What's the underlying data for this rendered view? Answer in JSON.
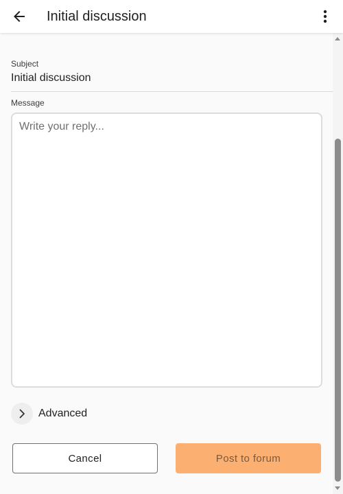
{
  "header": {
    "title": "Initial discussion",
    "back_icon": "arrow-left-icon",
    "menu_icon": "more-vert-icon"
  },
  "form": {
    "subject_label": "Subject",
    "subject_value": "Initial discussion",
    "message_label": "Message",
    "message_placeholder": "Write your reply...",
    "message_value": "",
    "advanced_label": "Advanced"
  },
  "actions": {
    "cancel_label": "Cancel",
    "post_label": "Post to forum"
  },
  "colors": {
    "accent": "#fbb072",
    "accent_text": "#7a5a3e"
  }
}
